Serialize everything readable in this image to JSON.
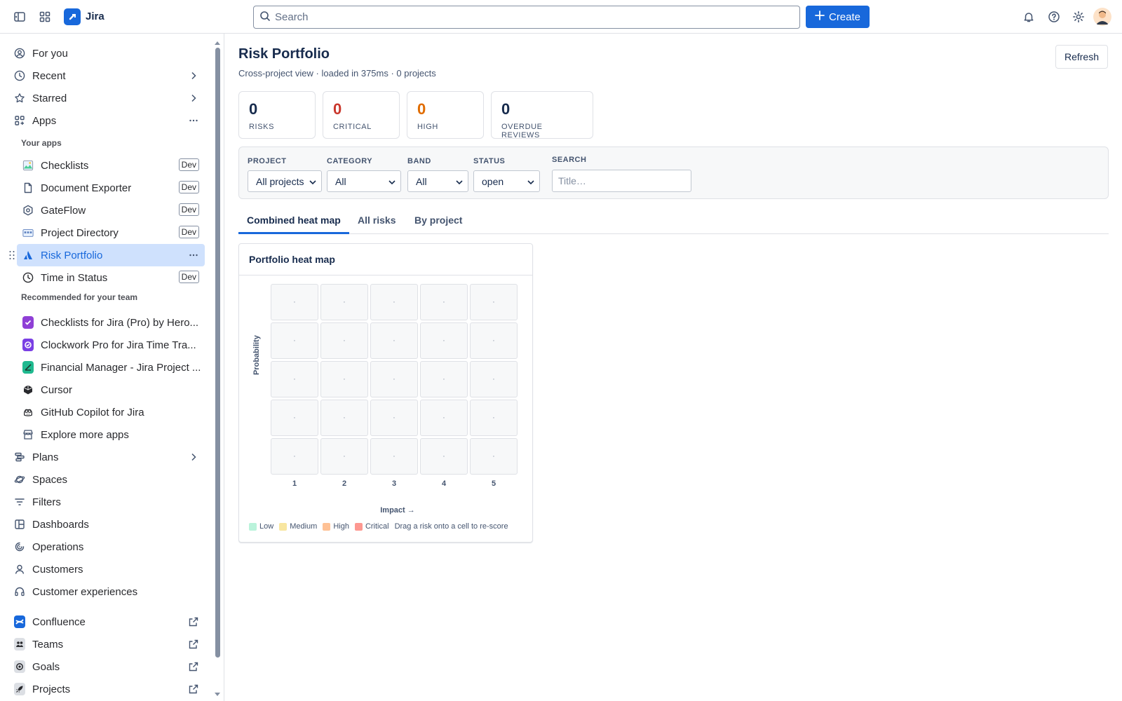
{
  "topbar": {
    "app_name": "Jira",
    "search_placeholder": "Search",
    "create_label": "Create"
  },
  "sidebar": {
    "for_you": "For you",
    "recent": "Recent",
    "starred": "Starred",
    "apps": "Apps",
    "your_apps_label": "Your apps",
    "your_apps": [
      {
        "label": "Checklists",
        "badge": "Dev"
      },
      {
        "label": "Document Exporter",
        "badge": "Dev"
      },
      {
        "label": "GateFlow",
        "badge": "Dev"
      },
      {
        "label": "Project Directory",
        "badge": "Dev"
      },
      {
        "label": "Risk Portfolio",
        "badge": ""
      },
      {
        "label": "Time in Status",
        "badge": "Dev"
      }
    ],
    "recommended_label": "Recommended for your team",
    "recommended": [
      {
        "label": "Checklists for Jira (Pro) by Hero..."
      },
      {
        "label": "Clockwork Pro for Jira Time Tra..."
      },
      {
        "label": "Financial Manager - Jira Project ..."
      },
      {
        "label": "Cursor"
      },
      {
        "label": "GitHub Copilot for Jira"
      },
      {
        "label": "Explore more apps"
      }
    ],
    "plans": "Plans",
    "spaces": "Spaces",
    "filters": "Filters",
    "dashboards": "Dashboards",
    "operations": "Operations",
    "customers": "Customers",
    "customer_experiences": "Customer experiences",
    "external": [
      {
        "label": "Confluence"
      },
      {
        "label": "Teams"
      },
      {
        "label": "Goals"
      },
      {
        "label": "Projects"
      }
    ]
  },
  "page": {
    "title": "Risk Portfolio",
    "subtitle": "Cross-project view · loaded in 375ms · 0 projects",
    "refresh_label": "Refresh"
  },
  "stats": [
    {
      "value": "0",
      "label": "RISKS",
      "color": "#172b4d"
    },
    {
      "value": "0",
      "label": "CRITICAL",
      "color": "#c9372c"
    },
    {
      "value": "0",
      "label": "HIGH",
      "color": "#e06c00"
    },
    {
      "value": "0",
      "label": "OVERDUE REVIEWS",
      "color": "#172b4d"
    }
  ],
  "filters": {
    "project": {
      "label": "PROJECT",
      "value": "All projects"
    },
    "category": {
      "label": "CATEGORY",
      "value": "All"
    },
    "band": {
      "label": "BAND",
      "value": "All"
    },
    "status": {
      "label": "STATUS",
      "value": "open"
    },
    "search": {
      "label": "SEARCH",
      "placeholder": "Title…"
    }
  },
  "tabs": [
    {
      "label": "Combined heat map",
      "active": true
    },
    {
      "label": "All risks",
      "active": false
    },
    {
      "label": "By project",
      "active": false
    }
  ],
  "heatmap": {
    "title": "Portfolio heat map",
    "ylabel": "Probability",
    "xlabel": "Impact →",
    "x_ticks": [
      "1",
      "2",
      "3",
      "4",
      "5"
    ],
    "cell_placeholder": "·",
    "legend": [
      {
        "label": "Low",
        "color": "#baf3db"
      },
      {
        "label": "Medium",
        "color": "#f8e6a0"
      },
      {
        "label": "High",
        "color": "#fec195"
      },
      {
        "label": "Critical",
        "color": "#fd9891"
      }
    ],
    "hint": "Drag a risk onto a cell to re-score"
  }
}
